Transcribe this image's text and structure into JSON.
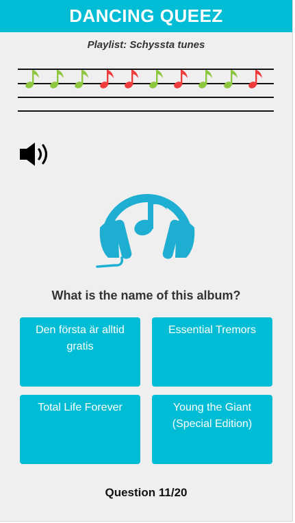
{
  "header": {
    "title": "DANCING QUEEZ"
  },
  "playlist": {
    "label": "Playlist: Schyssta tunes"
  },
  "progress": {
    "notes": [
      "correct",
      "correct",
      "correct",
      "wrong",
      "wrong",
      "correct",
      "wrong",
      "correct",
      "correct",
      "wrong"
    ],
    "colors": {
      "correct": "#8dc63f",
      "wrong": "#ef3b3b"
    }
  },
  "speaker": {
    "icon": "speaker-icon"
  },
  "logo": {
    "icon": "headphones-music-note-icon",
    "color": "#1eaed2"
  },
  "question": {
    "text": "What is the name of this album?"
  },
  "answers": [
    {
      "label": "Den första är alltid gratis"
    },
    {
      "label": "Essential Tremors"
    },
    {
      "label": "Total Life Forever"
    },
    {
      "label": "Young the Giant (Special Edition)"
    }
  ],
  "footer": {
    "counter": "Question 11/20"
  },
  "colors": {
    "accent": "#00bcd4",
    "background": "#efefef"
  }
}
